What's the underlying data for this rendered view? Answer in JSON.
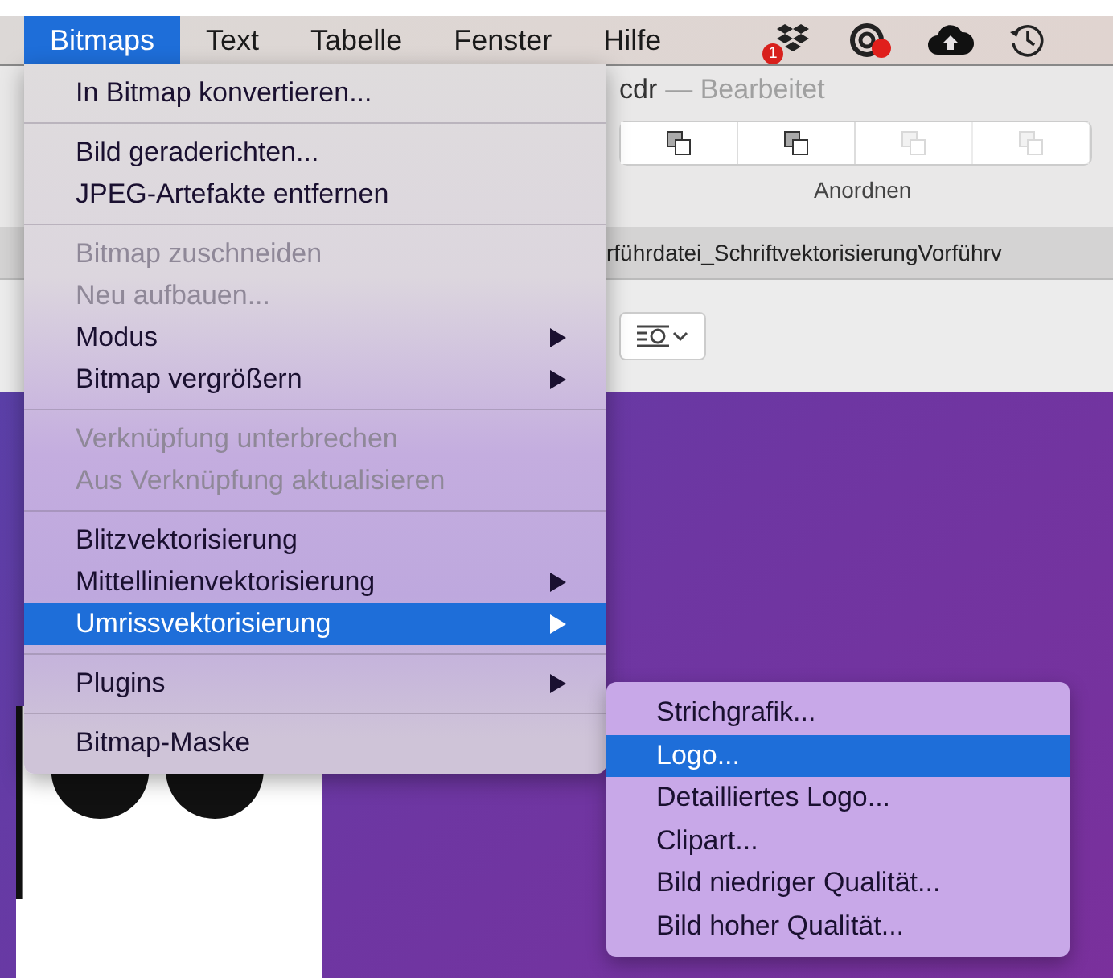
{
  "menubar": {
    "items": [
      {
        "label": "Bitmaps",
        "selected": true
      },
      {
        "label": "Text",
        "selected": false
      },
      {
        "label": "Tabelle",
        "selected": false
      },
      {
        "label": "Fenster",
        "selected": false
      },
      {
        "label": "Hilfe",
        "selected": false
      }
    ],
    "notification_badge": "1"
  },
  "window": {
    "title": "cdr",
    "status": "— Bearbeitet",
    "arrange_buttons": [
      {
        "disabled": false
      },
      {
        "disabled": false
      },
      {
        "disabled": true
      },
      {
        "disabled": true
      }
    ],
    "arrange_label": "Anordnen",
    "document_tab": "rführdatei_SchriftvektorisierungVorführv"
  },
  "menu": {
    "items": [
      {
        "kind": "item",
        "label": "In Bitmap konvertieren...",
        "disabled": false,
        "submenu": false,
        "selected": false
      },
      {
        "kind": "separator"
      },
      {
        "kind": "item",
        "label": "Bild geraderichten...",
        "disabled": false,
        "submenu": false,
        "selected": false
      },
      {
        "kind": "item",
        "label": "JPEG-Artefakte entfernen",
        "disabled": false,
        "submenu": false,
        "selected": false
      },
      {
        "kind": "separator"
      },
      {
        "kind": "item",
        "label": "Bitmap zuschneiden",
        "disabled": true,
        "submenu": false,
        "selected": false
      },
      {
        "kind": "item",
        "label": "Neu aufbauen...",
        "disabled": true,
        "submenu": false,
        "selected": false
      },
      {
        "kind": "item",
        "label": "Modus",
        "disabled": false,
        "submenu": true,
        "selected": false
      },
      {
        "kind": "item",
        "label": "Bitmap vergrößern",
        "disabled": false,
        "submenu": true,
        "selected": false
      },
      {
        "kind": "separator"
      },
      {
        "kind": "item",
        "label": "Verknüpfung unterbrechen",
        "disabled": true,
        "submenu": false,
        "selected": false
      },
      {
        "kind": "item",
        "label": "Aus Verknüpfung aktualisieren",
        "disabled": true,
        "submenu": false,
        "selected": false
      },
      {
        "kind": "separator"
      },
      {
        "kind": "item",
        "label": "Blitzvektorisierung",
        "disabled": false,
        "submenu": false,
        "selected": false
      },
      {
        "kind": "item",
        "label": "Mittellinienvektorisierung",
        "disabled": false,
        "submenu": true,
        "selected": false
      },
      {
        "kind": "item",
        "label": "Umrissvektorisierung",
        "disabled": false,
        "submenu": true,
        "selected": true
      },
      {
        "kind": "separator"
      },
      {
        "kind": "item",
        "label": "Plugins",
        "disabled": false,
        "submenu": true,
        "selected": false
      },
      {
        "kind": "separator"
      },
      {
        "kind": "item",
        "label": "Bitmap-Maske",
        "disabled": false,
        "submenu": false,
        "selected": false
      }
    ]
  },
  "submenu": {
    "items": [
      {
        "label": "Strichgrafik...",
        "selected": false
      },
      {
        "label": "Logo...",
        "selected": true
      },
      {
        "label": "Detailliertes Logo...",
        "selected": false
      },
      {
        "label": "Clipart...",
        "selected": false
      },
      {
        "label": "Bild niedriger Qualität...",
        "selected": false
      },
      {
        "label": "Bild hoher Qualität...",
        "selected": false
      }
    ]
  }
}
